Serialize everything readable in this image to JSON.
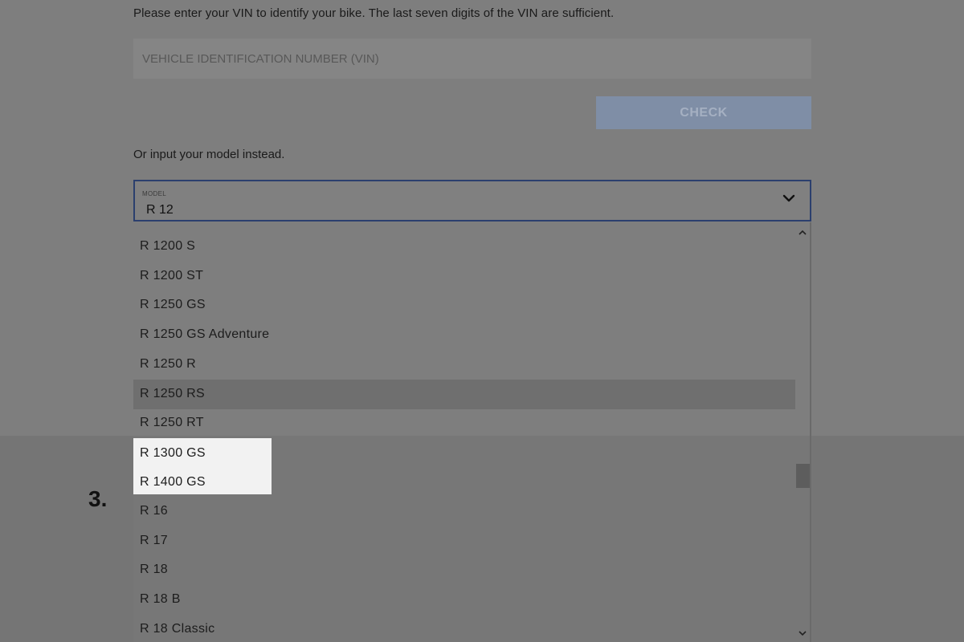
{
  "intro_text": "Please enter your VIN to identify your bike. The last seven digits of the VIN are sufficient.",
  "vin": {
    "placeholder": "VEHICLE IDENTIFICATION NUMBER (VIN)",
    "value": ""
  },
  "check_button": "CHECK",
  "or_text": "Or input your model instead.",
  "model_select": {
    "label": "MODEL",
    "value": "R 12",
    "icon": "chevron-down-icon"
  },
  "options": [
    "R 1200 S",
    "R 1200 ST",
    "R 1250 GS",
    "R 1250 GS Adventure",
    "R 1250 R",
    "R 1250 RS",
    "R 1250 RT",
    "R 1300 GS",
    "R 1400 GS",
    "R 16",
    "R 17",
    "R 18",
    "R 18 B",
    "R 18 Classic"
  ],
  "hovered_option": "R 1250 RS",
  "highlighted_options": [
    "R 1300 GS",
    "R 1400 GS"
  ],
  "step_marker": "3.",
  "colors": {
    "focus_border": "#2b3f6e",
    "check_button_bg": "#7f8ea6",
    "highlight_bg": "#f2f2f2"
  }
}
